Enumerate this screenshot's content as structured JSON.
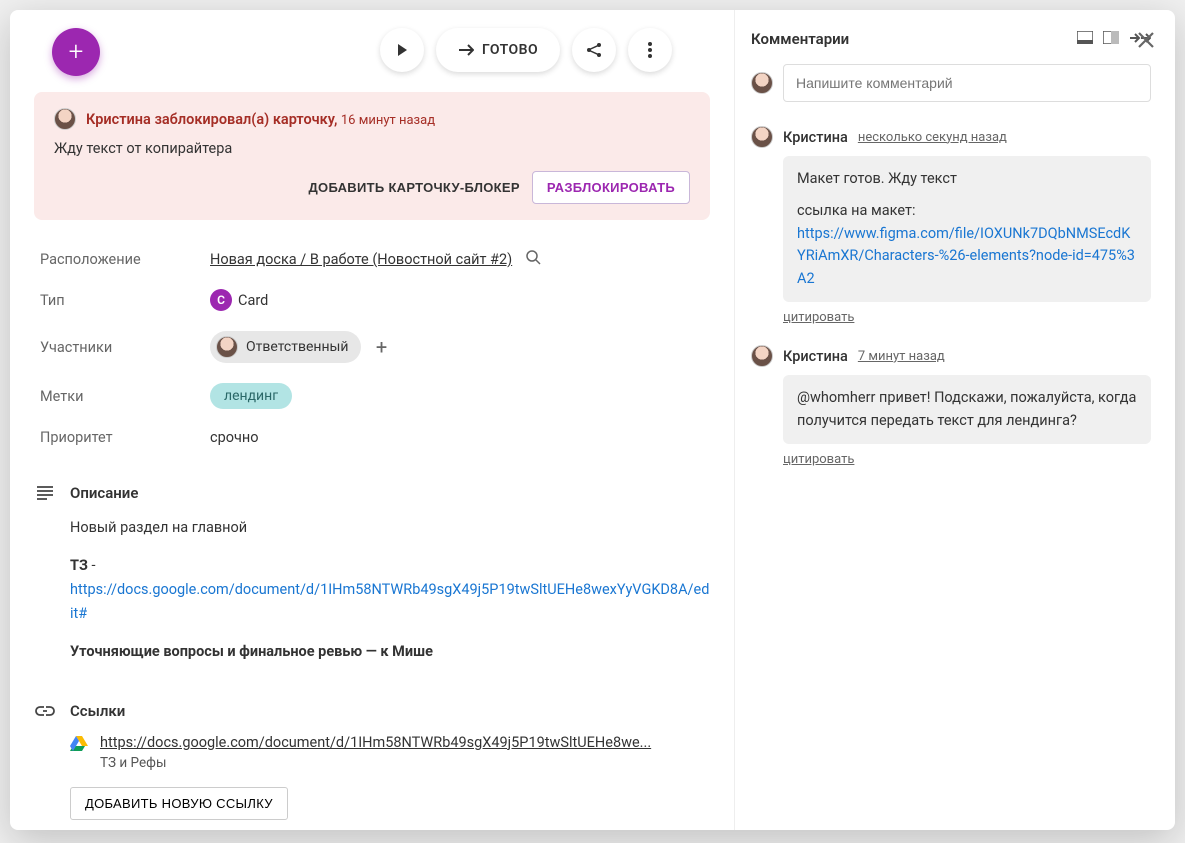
{
  "toolbar": {
    "done_label": "ГОТОВО"
  },
  "alert": {
    "author": "Кристина",
    "action_text": "заблокировал(а) карточку,",
    "time": "16 минут назад",
    "body": "Жду текст от копирайтера",
    "add_blocker_btn": "ДОБАВИТЬ КАРТОЧКУ-БЛОКЕР",
    "unblock_btn": "РАЗБЛОКИРОВАТЬ"
  },
  "props": {
    "location_label": "Расположение",
    "location_value": "Новая доска / В работе (Новостной сайт #2)",
    "type_label": "Тип",
    "type_letter": "C",
    "type_value": "Card",
    "members_label": "Участники",
    "responsible_label": "Ответственный",
    "tags_label": "Метки",
    "tag_value": "лендинг",
    "priority_label": "Приоритет",
    "priority_value": "срочно"
  },
  "description": {
    "title": "Описание",
    "line1": "Новый раздел на главной",
    "tz_label": "ТЗ",
    "tz_sep": " - ",
    "tz_link": "https://docs.google.com/document/d/1IHm58NTWRb49sgX49j5P19twSltUEHe8wexYyVGKD8A/edit#",
    "line3": "Уточняющие вопросы и финальное ревью — к Мише"
  },
  "links": {
    "title": "Ссылки",
    "url": "https://docs.google.com/document/d/1IHm58NTWRb49sgX49j5P19twSltUEHe8we...",
    "subtitle": "ТЗ и Рефы",
    "add_btn": "ДОБАВИТЬ НОВУЮ ССЫЛКУ"
  },
  "sidebar": {
    "title": "Комментарии",
    "compose_placeholder": "Напишите комментарий",
    "quote_label": "цитировать",
    "comments": [
      {
        "author": "Кристина",
        "time": "несколько секунд назад",
        "body1": "Макет готов. Жду текст",
        "body2_prefix": "ссылка на макет:",
        "body2_link": "https://www.figma.com/file/IOXUNk7DQbNMSEcdKYRiAmXR/Characters-%26-elements?node-id=475%3A2"
      },
      {
        "author": "Кристина",
        "time": "7 минут назад",
        "body1": "@whomherr привет! Подскажи, пожалуйста, когда получится передать текст для лендинга?"
      }
    ]
  }
}
